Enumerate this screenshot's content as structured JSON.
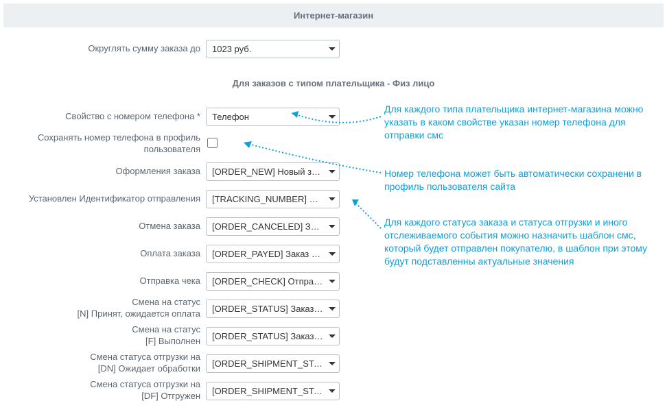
{
  "header": {
    "title": "Интернет-магазин"
  },
  "rounding": {
    "label": "Округлять сумму заказа до",
    "value": "1023 руб."
  },
  "sub_header": {
    "title": "Для заказов с типом плательщика - Физ лицо"
  },
  "rows": {
    "phone_prop": {
      "label": "Свойство с номером телефона *",
      "value": "Телефон"
    },
    "save_phone": {
      "label": "Сохранять номер телефона в профиль пользователя"
    },
    "order_new": {
      "label": "Оформления заказа",
      "value": "[ORDER_NEW] Новый зака"
    },
    "tracking": {
      "label": "Установлен Идентификатор отправления",
      "value": "[TRACKING_NUMBER] Доба"
    },
    "cancel": {
      "label": "Отмена заказа",
      "value": "[ORDER_CANCELED] Зака"
    },
    "pay": {
      "label": "Оплата заказа",
      "value": "[ORDER_PAYED] Заказ опл"
    },
    "check": {
      "label": "Отправка чека",
      "value": "[ORDER_CHECK] Отправка"
    },
    "status_n": {
      "label": "Смена на статус\n[N] Принят, ожидается оплата",
      "value": "[ORDER_STATUS] Заказ - с"
    },
    "status_f": {
      "label": "Смена на статус\n[F] Выполнен",
      "value": "[ORDER_STATUS] Заказ - с"
    },
    "ship_dn": {
      "label": "Смена статуса отгрузки на\n[DN] Ожидает обработки",
      "value": "[ORDER_SHIPMENT_STATU"
    },
    "ship_df": {
      "label": "Смена статуса отгрузки на\n[DF] Отгружен",
      "value": "[ORDER_SHIPMENT_STATU"
    }
  },
  "annotations": {
    "a1": "Для каждого типа плательщика интернет-магазина можно указать в каком свойстве указан номер телефона для отправки смс",
    "a2": "Номер телефона может быть автоматически сохранени в профиль пользователя сайта",
    "a3": "Для каждого статуса заказа и статуса отгрузки и иного отслеживаемого события можно назначить шаблон смс, который будет отправлен покупателю, в шаблон при этому будут подставленны актуальные значения"
  }
}
